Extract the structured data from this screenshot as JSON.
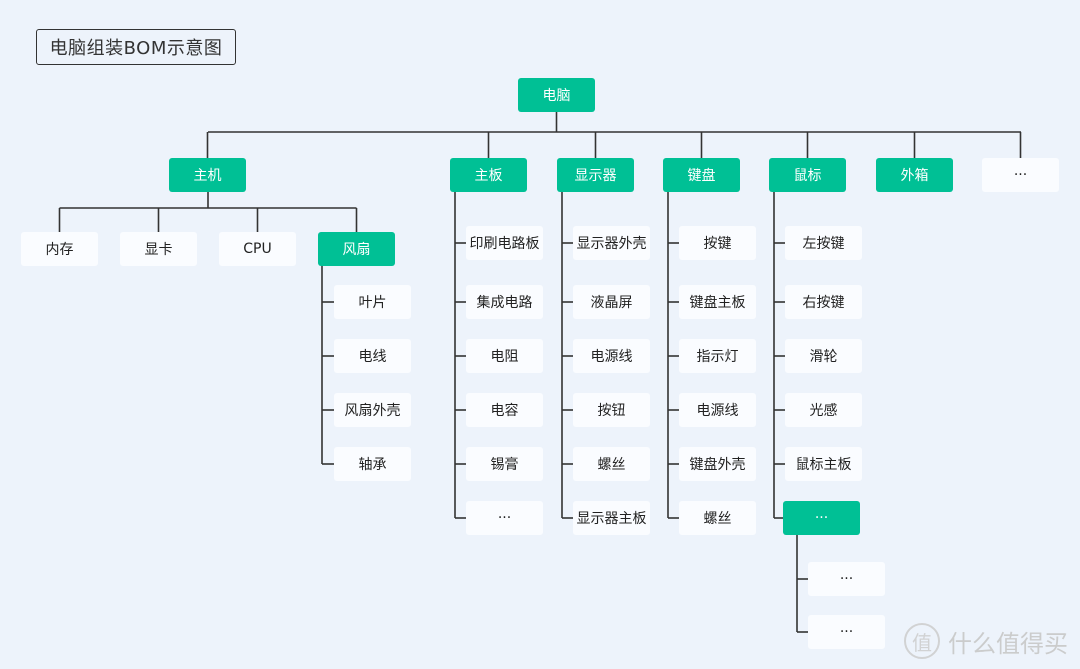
{
  "title": "电脑组装BOM示意图",
  "colors": {
    "accent": "#00c095",
    "background": "#edf3fb",
    "line": "#333333",
    "leaf": "#fafcff"
  },
  "root": {
    "label": "电脑"
  },
  "categories": [
    {
      "label": "主机",
      "highlight": true,
      "children": [
        {
          "label": "内存",
          "highlight": false
        },
        {
          "label": "显卡",
          "highlight": false
        },
        {
          "label": "CPU",
          "highlight": false
        },
        {
          "label": "风扇",
          "highlight": true,
          "children": [
            {
              "label": "叶片"
            },
            {
              "label": "电线"
            },
            {
              "label": "风扇外壳"
            },
            {
              "label": "轴承"
            }
          ]
        }
      ]
    },
    {
      "label": "主板",
      "highlight": true,
      "children": [
        {
          "label": "印刷电路板"
        },
        {
          "label": "集成电路"
        },
        {
          "label": "电阻"
        },
        {
          "label": "电容"
        },
        {
          "label": "锡膏"
        },
        {
          "label": "···"
        }
      ]
    },
    {
      "label": "显示器",
      "highlight": true,
      "children": [
        {
          "label": "显示器外壳"
        },
        {
          "label": "液晶屏"
        },
        {
          "label": "电源线"
        },
        {
          "label": "按钮"
        },
        {
          "label": "螺丝"
        },
        {
          "label": "显示器主板"
        }
      ]
    },
    {
      "label": "键盘",
      "highlight": true,
      "children": [
        {
          "label": "按键"
        },
        {
          "label": "键盘主板"
        },
        {
          "label": "指示灯"
        },
        {
          "label": "电源线"
        },
        {
          "label": "键盘外壳"
        },
        {
          "label": "螺丝"
        }
      ]
    },
    {
      "label": "鼠标",
      "highlight": true,
      "children": [
        {
          "label": "左按键"
        },
        {
          "label": "右按键"
        },
        {
          "label": "滑轮"
        },
        {
          "label": "光感"
        },
        {
          "label": "鼠标主板"
        },
        {
          "label": "···",
          "highlight": true,
          "children": [
            {
              "label": "···"
            },
            {
              "label": "···"
            }
          ]
        }
      ]
    },
    {
      "label": "外箱",
      "highlight": true
    },
    {
      "label": "···",
      "highlight": false
    }
  ],
  "watermark": {
    "icon": "值",
    "text": "什么值得买"
  }
}
